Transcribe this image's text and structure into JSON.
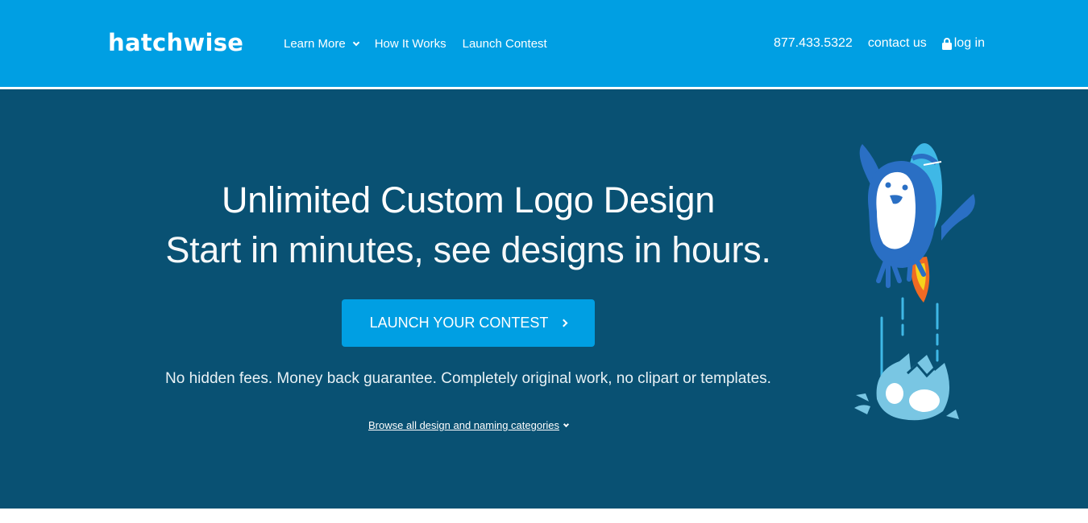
{
  "header": {
    "logo": "hatchwise",
    "nav": [
      {
        "label": "Learn More",
        "has_dropdown": true
      },
      {
        "label": "How It Works",
        "has_dropdown": false
      },
      {
        "label": "Launch Contest",
        "has_dropdown": false
      }
    ],
    "phone": "877.433.5322",
    "contact_label": "contact us",
    "login_label": "log in",
    "login_icon": "lock-icon"
  },
  "hero": {
    "title": "Unlimited Custom Logo Design",
    "subtitle": "Start in minutes, see designs in hours.",
    "cta_label": "LAUNCH YOUR CONTEST",
    "cta_icon": "chevron-right-icon",
    "note": "No hidden fees. Money back guarantee. Completely original work, no clipart or templates.",
    "browse_label": "Browse all design and naming categories",
    "browse_icon": "chevron-down-icon",
    "illustration": "penguin-rocket-hatched-egg"
  },
  "colors": {
    "header_bg": "#009fe3",
    "hero_bg": "#095173",
    "cta_bg": "#009fe3",
    "text": "#ffffff"
  }
}
